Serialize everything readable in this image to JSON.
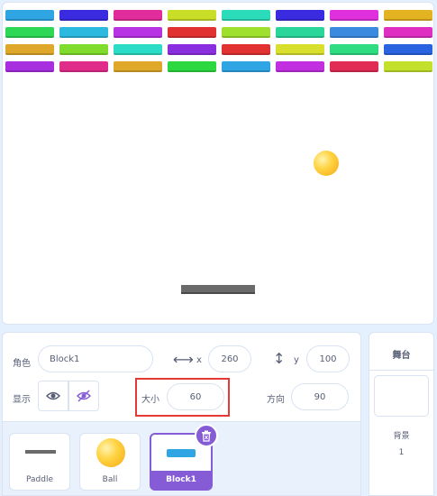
{
  "bricks": {
    "rows": [
      [
        "#2fa5e3",
        "#3a2be0",
        "#e12d9b",
        "#c9de27",
        "#2bdcba",
        "#3a2be0",
        "#e02fdc",
        "#e3b321"
      ],
      [
        "#2cd855",
        "#2cb9e0",
        "#b733e3",
        "#e13131",
        "#9fdf2d",
        "#2ad69a",
        "#3a8ae0",
        "#df2fc2"
      ],
      [
        "#e0a82a",
        "#7fdc2d",
        "#2bdcc6",
        "#8a2fe0",
        "#e13131",
        "#d8e02d",
        "#2fdc82",
        "#2a63e0"
      ],
      [
        "#a82fe0",
        "#e12d8a",
        "#e0a82a",
        "#2cd840",
        "#2fa5e3",
        "#c12fe0",
        "#e12d55",
        "#c3e02d"
      ]
    ]
  },
  "ball": {
    "color": "#ffd445"
  },
  "paddle": {
    "color": "#6a6a6a"
  },
  "sprite_info": {
    "sprite_label": "角色",
    "sprite_name": "Block1",
    "x_label": "x",
    "x_value": "260",
    "y_label": "y",
    "y_value": "100",
    "show_label": "显示",
    "size_label": "大小",
    "size_value": "60",
    "direction_label": "方向",
    "direction_value": "90"
  },
  "sprites": [
    {
      "name": "Paddle"
    },
    {
      "name": "Ball"
    },
    {
      "name": "Block1",
      "selected": true
    }
  ],
  "stage_panel": {
    "title": "舞台",
    "backdrops_label": "背景",
    "backdrops_count": "1"
  },
  "accent_color": "#855cd6",
  "highlight_color": "#e53935"
}
